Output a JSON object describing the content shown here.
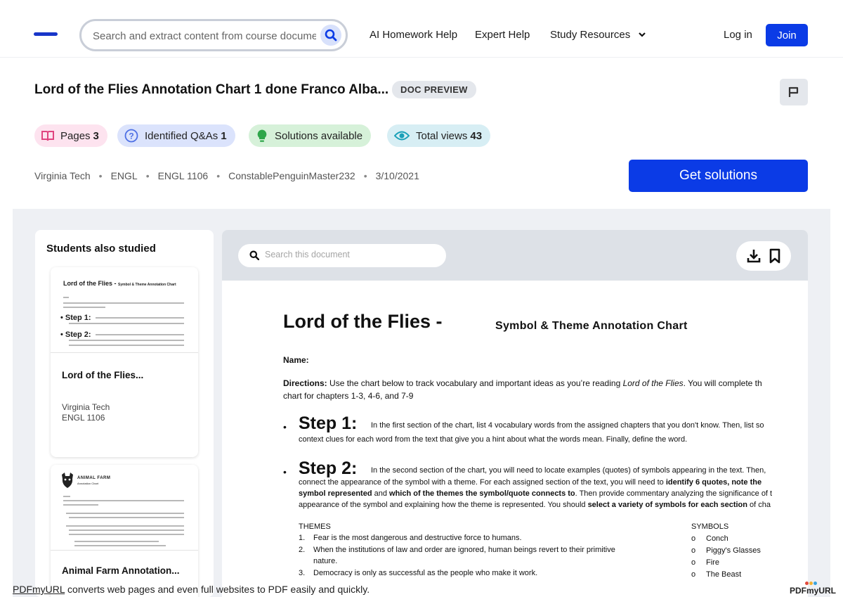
{
  "nav": {
    "search_placeholder": "Search and extract content from course documents, ",
    "links": [
      "AI Homework Help",
      "Expert Help",
      "Study Resources"
    ],
    "login": "Log in",
    "join": "Join",
    "accent_color": "#0b3be6"
  },
  "doc": {
    "title": "Lord of the Flies Annotation Chart 1 done Franco Alba...",
    "badge": "DOC PREVIEW",
    "pills": {
      "pages_label": "Pages",
      "pages_value": "3",
      "qa_label": "Identified Q&As",
      "qa_value": "1",
      "solutions_label": "Solutions available",
      "views_label": "Total views",
      "views_value": "43"
    },
    "meta": [
      "Virginia Tech",
      "ENGL",
      "ENGL 1106",
      "ConstablePenguinMaster232",
      "3/10/2021"
    ],
    "cta": "Get solutions"
  },
  "sidebar": {
    "title": "Students also studied",
    "cards": [
      {
        "title": "Lord of the Flies...",
        "school": "Virginia Tech",
        "course": "ENGL 1106",
        "thumb_heading": "Lord of the Flies -",
        "thumb_sub": "Symbol & Theme Annotation Chart"
      },
      {
        "title": "Animal Farm Annotation...",
        "thumb_heading": "ANIMAL FARM",
        "thumb_sub": "Annotation Chart"
      }
    ]
  },
  "viewer": {
    "search_placeholder": "Search this document",
    "page": {
      "title": "Lord of the Flies -",
      "subtitle": "Symbol & Theme Annotation Chart",
      "name_label": "Name:",
      "directions_label": "Directions:",
      "directions_text": " Use the chart below to track vocabulary and important ideas as you’re reading ",
      "directions_italic": "Lord of the Flies",
      "directions_tail": ". You will complete th",
      "directions_line2": "chart for chapters 1-3, 4-6, and 7-9",
      "step1_label": "Step 1:",
      "step1_text": " In the first section of the chart, list 4 vocabulary words from the assigned chapters that you don't know. Then, list so",
      "step1_line2": "context clues for each word from the text that give you a hint about what the words mean. Finally, define the word.",
      "step2_label": "Step 2:",
      "step2_text": " In the second section of the chart, you will need to locate examples (quotes) of symbols appearing in the text. Then,",
      "step2_line2a": "connect the appearance of the symbol with a theme. For each assigned section of the text, you will need to ",
      "step2_line2b": "identify 6 quotes, note the",
      "step2_line3a": "symbol represented",
      "step2_line3b": " and ",
      "step2_line3c": "which of the themes the symbol/quote connects to",
      "step2_line3d": ". Then provide commentary analyzing the significance of t",
      "step2_line4a": "appearance of the symbol and explaining how the theme is represented. You should ",
      "step2_line4b": "select a variety of symbols for each section",
      "step2_line4c": " of cha",
      "themes_heading": "THEMES",
      "themes": [
        "Fear is the most dangerous and destructive force to humans.",
        "When the institutions of law and order are ignored, human beings revert to their primitive",
        "Democracy is only as successful as the people who make it work."
      ],
      "theme2_cont": "nature.",
      "symbols_heading": "SYMBOLS",
      "symbols": [
        "Conch",
        "Piggy's Glasses",
        "Fire",
        "The Beast"
      ],
      "symbol_marker": "o"
    }
  },
  "footer": {
    "link": "PDFmyURL",
    "text": " converts web pages and even full websites to PDF easily and quickly.",
    "logo": "PDFmyURL"
  }
}
